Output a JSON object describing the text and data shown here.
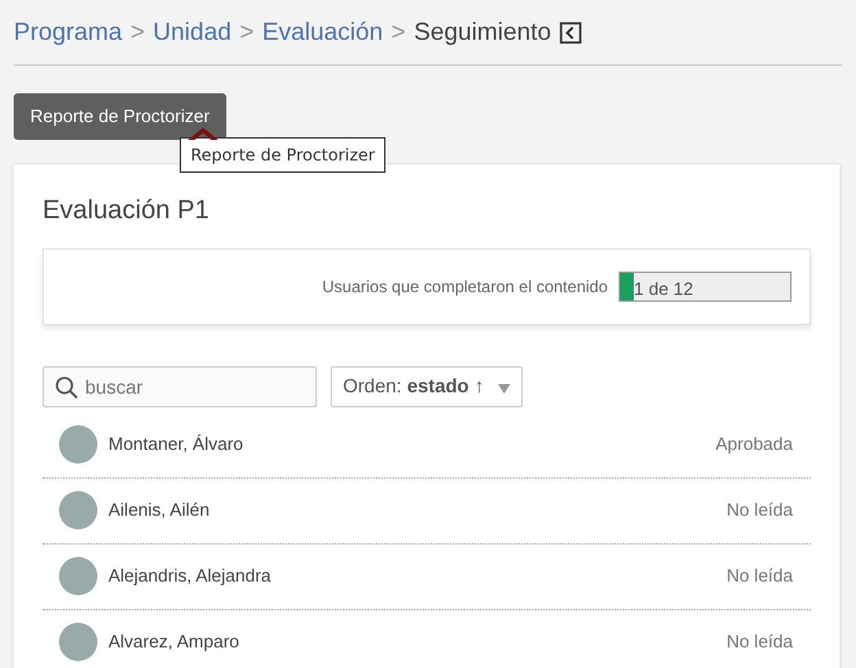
{
  "breadcrumb": [
    {
      "label": "Programa",
      "kind": "link"
    },
    {
      "label": "Unidad",
      "kind": "link"
    },
    {
      "label": "Evaluación",
      "kind": "link"
    },
    {
      "label": "Seguimiento",
      "kind": "current"
    }
  ],
  "breadcrumb_separator": ">",
  "report_button": {
    "label": "Reporte de Proctorizer",
    "tooltip": "Reporte de Proctorizer"
  },
  "card": {
    "title": "Evaluación P1",
    "completion": {
      "label": "Usuarios que completaron el contenido",
      "level": 0.083,
      "reading": "1 de 12"
    },
    "search": {
      "placeholder": "buscar"
    },
    "sort": {
      "label": "Orden: **estado**",
      "direction": "↑"
    },
    "users": [
      {
        "name": "Montaner, Álvaro",
        "status": "Aprobada"
      },
      {
        "name": "Ailenis, Ailén",
        "status": "No leída"
      },
      {
        "name": "Alejandris, Alejandra",
        "status": "No leída"
      },
      {
        "name": "Alvarez, Amparo",
        "status": "No leída"
      }
    ]
  }
}
